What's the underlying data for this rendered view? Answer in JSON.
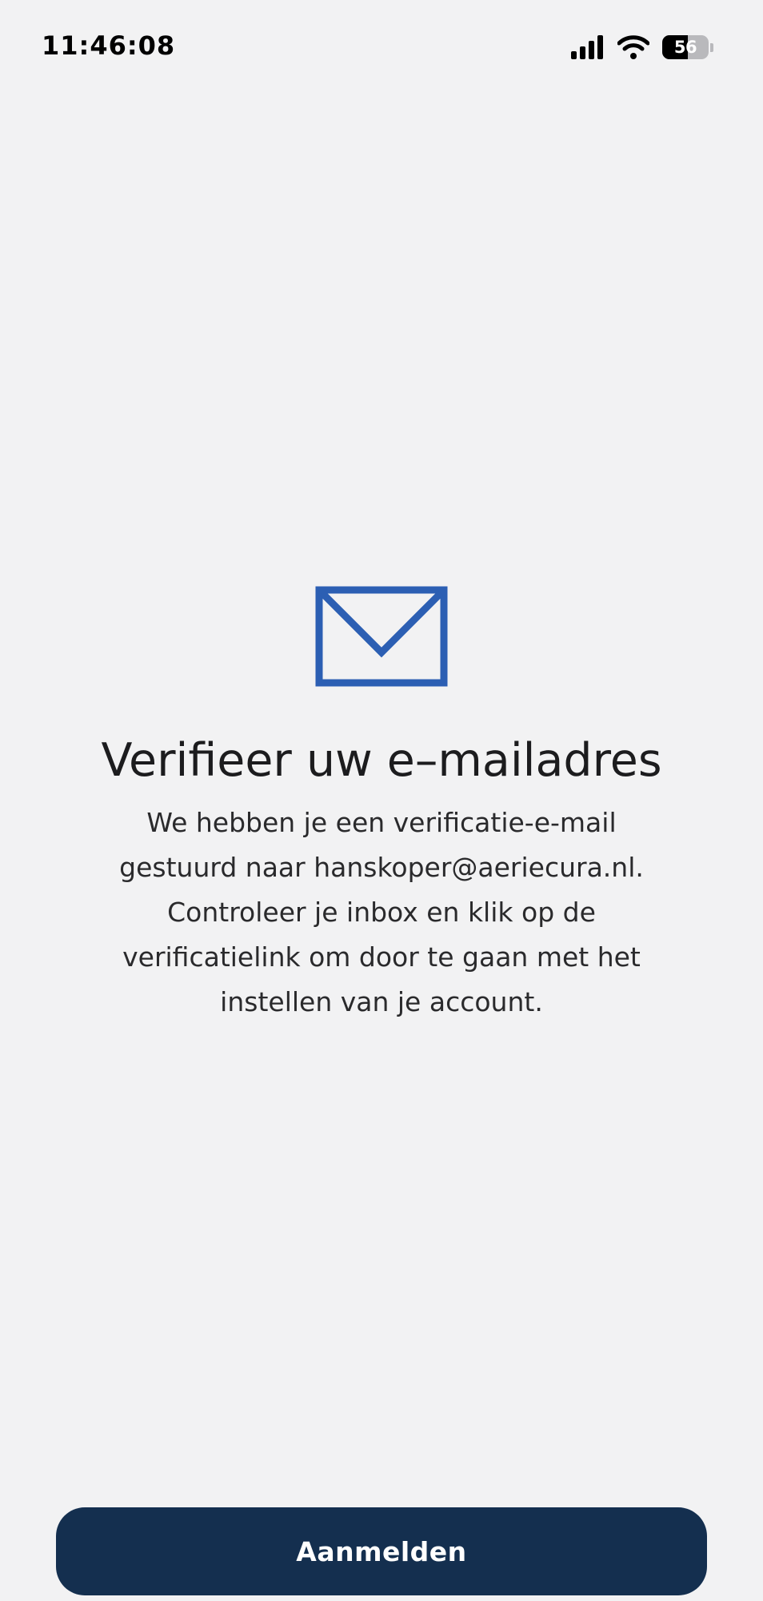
{
  "status_bar": {
    "time": "11:46:08",
    "battery_level": "56",
    "battery_fraction": 0.56,
    "icons": [
      "signal-icon",
      "wifi-icon",
      "battery-icon"
    ]
  },
  "main": {
    "icon": "envelope-icon",
    "title": "Verifieer uw e–mailadres",
    "description": "We hebben je een verificatie-e-mail gestuurd naar hanskoper@aeriecura.nl. Controleer je inbox en klik op de verificatielink om door te gaan met het instellen van je account."
  },
  "actions": {
    "login_label": "Aanmelden"
  },
  "colors": {
    "background": "#f2f2f3",
    "accent": "#2c5fb3",
    "button": "#142f4f",
    "button_text": "#ffffff"
  }
}
